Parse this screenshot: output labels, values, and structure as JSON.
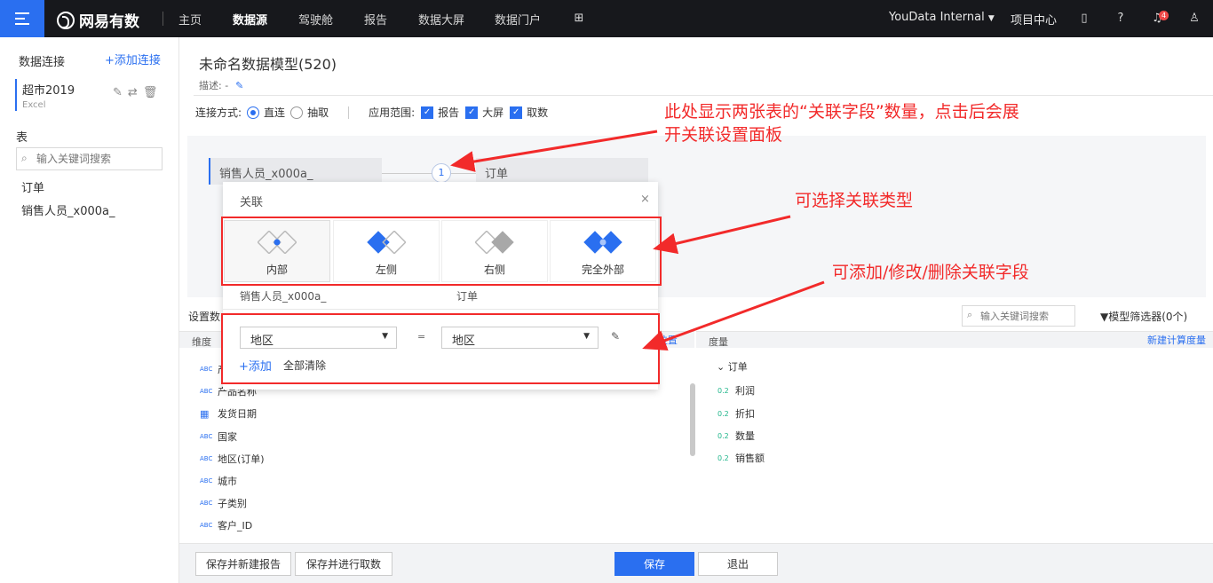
{
  "nav": {
    "logo": "网易有数",
    "items": [
      "主页",
      "数据源",
      "驾驶舱",
      "报告",
      "数据大屏",
      "数据门户"
    ],
    "active": "数据源",
    "org": "YouData Internal",
    "project_center": "项目中心",
    "notification_count": "4"
  },
  "sidebar": {
    "title": "数据连接",
    "add_label": "+添加连接",
    "connection": {
      "name": "超市2019",
      "type": "Excel"
    },
    "table_title": "表",
    "search_placeholder": "输入关键词搜索",
    "tables": [
      "订单",
      "销售人员_x000a_"
    ]
  },
  "main": {
    "title": "未命名数据模型(520)",
    "desc_label": "描述: -",
    "conn_mode_label": "连接方式:",
    "mode_direct": "直连",
    "mode_extract": "抽取",
    "scope_label": "应用范围:",
    "scope_report": "报告",
    "scope_screen": "大屏",
    "scope_fetch": "取数"
  },
  "canvas": {
    "left_table": "销售人员_x000a_",
    "right_table": "订单",
    "join_count": "1"
  },
  "join_panel": {
    "title": "关联",
    "close": "×",
    "types": [
      "内部",
      "左侧",
      "右侧",
      "完全外部"
    ],
    "left_table": "销售人员_x000a_",
    "right_table": "订单",
    "left_field": "地区",
    "right_field": "地区",
    "eq": "=",
    "add_label": "+添加",
    "clear_label": "全部清除"
  },
  "fields": {
    "settings_label": "设置数",
    "search_placeholder": "输入关键词搜索",
    "filter_label": "模型筛选器(0个)",
    "dim_header": "维度",
    "measure_header": "度量",
    "hidden_link": "置位置",
    "new_measure": "新建计算度量",
    "dimensions": [
      {
        "icon": "ABC",
        "name": "产"
      },
      {
        "icon": "ABC",
        "name": "产品名称"
      },
      {
        "icon": "calendar-icon",
        "name": "发货日期"
      },
      {
        "icon": "ABC",
        "name": "国家"
      },
      {
        "icon": "ABC",
        "name": "地区(订单)"
      },
      {
        "icon": "ABC",
        "name": "城市"
      },
      {
        "icon": "ABC",
        "name": "子类别"
      },
      {
        "icon": "ABC",
        "name": "客户_ID"
      }
    ],
    "measure_group": "订单",
    "measures": [
      "利润",
      "折扣",
      "数量",
      "销售额"
    ],
    "measure_icon": "0.2"
  },
  "bottom": {
    "save_new_report": "保存并新建报告",
    "save_fetch": "保存并进行取数",
    "save": "保存",
    "exit": "退出"
  },
  "annotations": {
    "a1": "此处显示两张表的“关联字段”数量，点击后会展开关联设置面板",
    "a1_line1": "此处显示两张表的“关联字段”数量，点击后会展",
    "a1_line2": "开关联设置面板",
    "a2": "可选择关联类型",
    "a3": "可添加/修改/删除关联字段"
  },
  "colors": {
    "accent": "#2a6ff0",
    "annotation": "#f22a2a",
    "nav_bg": "#17181c"
  }
}
